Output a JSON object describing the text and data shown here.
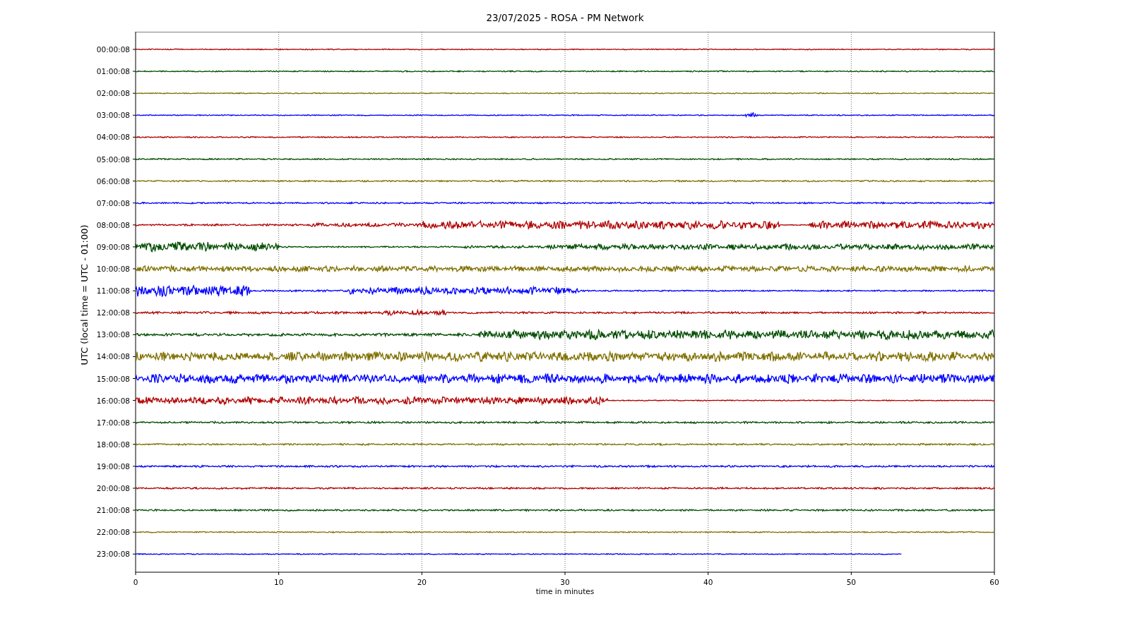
{
  "title": "23/07/2025 - ROSA - PM Network",
  "ylabel": "UTC (local time = UTC - 01:00)",
  "xlabel": "time in minutes",
  "xticks": [
    "0",
    "10",
    "20",
    "30",
    "40",
    "50",
    "60"
  ],
  "rows": [
    {
      "label": "00:00:08",
      "color": "#b00000"
    },
    {
      "label": "01:00:08",
      "color": "#004d00"
    },
    {
      "label": "02:00:08",
      "color": "#807000"
    },
    {
      "label": "03:00:08",
      "color": "#0000ff"
    },
    {
      "label": "04:00:08",
      "color": "#b00000"
    },
    {
      "label": "05:00:08",
      "color": "#004d00"
    },
    {
      "label": "06:00:08",
      "color": "#807000"
    },
    {
      "label": "07:00:08",
      "color": "#0000ff"
    },
    {
      "label": "08:00:08",
      "color": "#b00000"
    },
    {
      "label": "09:00:08",
      "color": "#004d00"
    },
    {
      "label": "10:00:08",
      "color": "#807000"
    },
    {
      "label": "11:00:08",
      "color": "#0000ff"
    },
    {
      "label": "12:00:08",
      "color": "#b00000"
    },
    {
      "label": "13:00:08",
      "color": "#004d00"
    },
    {
      "label": "14:00:08",
      "color": "#807000"
    },
    {
      "label": "15:00:08",
      "color": "#0000ff"
    },
    {
      "label": "16:00:08",
      "color": "#b00000"
    },
    {
      "label": "17:00:08",
      "color": "#004d00"
    },
    {
      "label": "18:00:08",
      "color": "#807000"
    },
    {
      "label": "19:00:08",
      "color": "#0000ff"
    },
    {
      "label": "20:00:08",
      "color": "#b00000"
    },
    {
      "label": "21:00:08",
      "color": "#004d00"
    },
    {
      "label": "22:00:08",
      "color": "#807000"
    },
    {
      "label": "23:00:08",
      "color": "#0000ff"
    }
  ]
}
